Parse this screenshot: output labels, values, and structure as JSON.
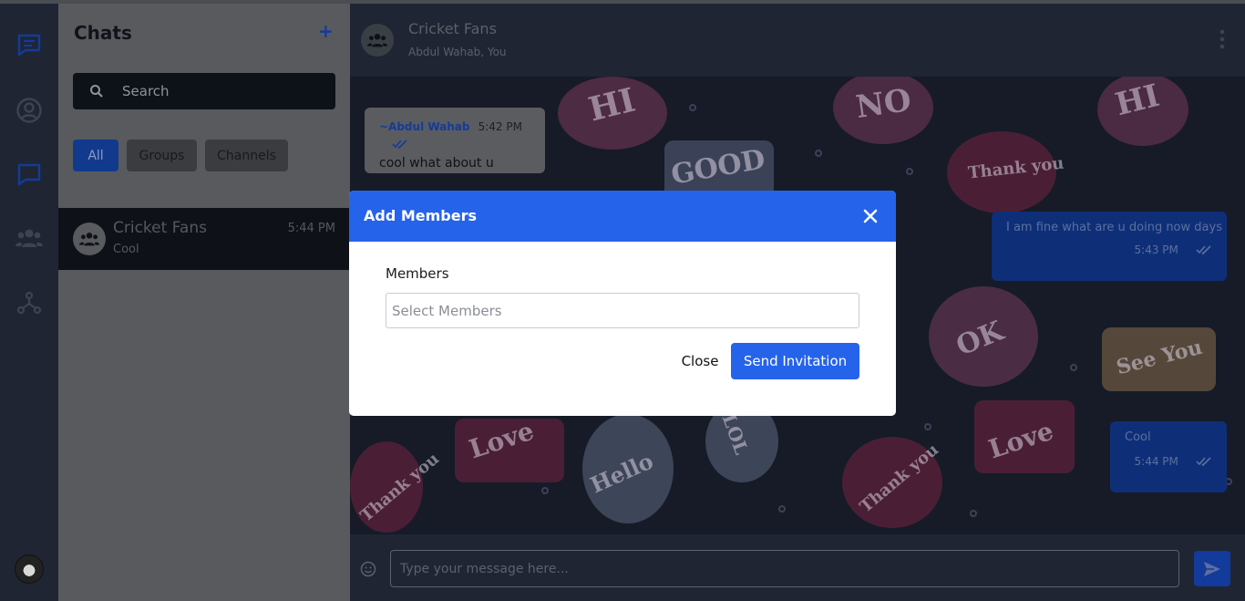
{
  "sidebar": {
    "title": "Chats",
    "add_label": "+",
    "search": {
      "placeholder": "Search"
    },
    "filters": [
      {
        "label": "All",
        "active": true
      },
      {
        "label": "Groups",
        "active": false
      },
      {
        "label": "Channels",
        "active": false
      }
    ],
    "chats": [
      {
        "name": "Cricket Fans",
        "time": "5:44 PM",
        "preview": "Cool"
      }
    ]
  },
  "rail": {
    "icons": [
      "chat-bubble-icon",
      "user-circle-icon",
      "message-square-icon",
      "users-icon",
      "share-nodes-icon"
    ]
  },
  "conversation": {
    "name": "Cricket Fans",
    "members": "Abdul Wahab, You",
    "messages": [
      {
        "direction": "in",
        "author": "~Abdul Wahab",
        "time": "5:42 PM",
        "text": "cool what about u"
      },
      {
        "direction": "out",
        "time": "5:43 PM",
        "text": "I am fine what are u doing now days"
      },
      {
        "direction": "out",
        "time": "5:44 PM",
        "text": "Cool"
      }
    ],
    "composer": {
      "placeholder": "Type your message here..."
    }
  },
  "wallpaper_words": [
    "HI",
    "NO",
    "GOOD",
    "Thank you",
    "OK",
    "See You",
    "Love",
    "Hello",
    "LOL"
  ],
  "modal": {
    "title": "Add Members",
    "field_label": "Members",
    "field_placeholder": "Select Members",
    "close_label": "Close",
    "submit_label": "Send Invitation"
  },
  "colors": {
    "accent": "#2563eb",
    "rail_bg": "#1f2533",
    "panel_overlay": "#585a5e"
  }
}
